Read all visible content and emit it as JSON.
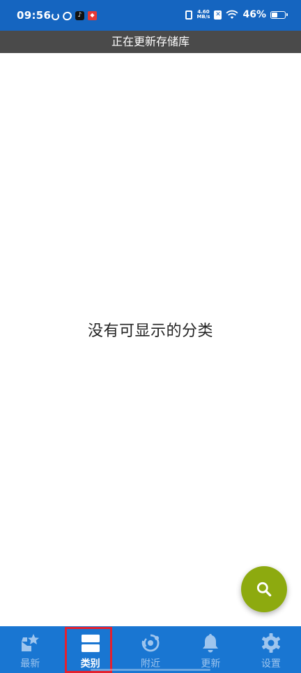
{
  "status_bar": {
    "time": "09:56",
    "net_speed_value": "4.60",
    "net_speed_unit": "MB/s",
    "battery": "46%",
    "battery_level": 0.46,
    "icons": [
      "refresh-icon",
      "app-oval-icon",
      "tiktok-icon",
      "red-app-icon",
      "vibrate-icon",
      "x-icon",
      "wifi-icon",
      "battery-icon"
    ]
  },
  "banner": {
    "text": "正在更新存储库"
  },
  "main": {
    "empty_message": "没有可显示的分类"
  },
  "fab": {
    "icon": "search-icon"
  },
  "bottom_nav": {
    "items": [
      {
        "label": "最新",
        "icon": "latest-star-icon"
      },
      {
        "label": "类别",
        "icon": "categories-icon",
        "active": true
      },
      {
        "label": "附近",
        "icon": "nearby-icon"
      },
      {
        "label": "更新",
        "icon": "bell-icon"
      },
      {
        "label": "设置",
        "icon": "gear-icon"
      }
    ]
  },
  "colors": {
    "status_bar": "#1565C0",
    "banner": "#4A4A4A",
    "fab": "#8DAA0F",
    "bottom_nav": "#1976D2",
    "highlight": "#E5202E"
  }
}
